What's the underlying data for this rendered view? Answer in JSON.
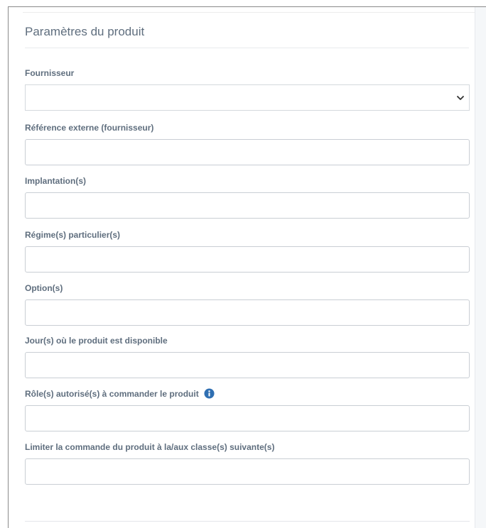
{
  "panel": {
    "title": "Paramètres du produit"
  },
  "fields": {
    "fournisseur": {
      "label": "Fournisseur",
      "value": ""
    },
    "reference_externe": {
      "label": "Référence externe (fournisseur)",
      "value": ""
    },
    "implantations": {
      "label": "Implantation(s)",
      "value": ""
    },
    "regimes": {
      "label": "Régime(s) particulier(s)",
      "value": ""
    },
    "options": {
      "label": "Option(s)",
      "value": ""
    },
    "jours": {
      "label": "Jour(s) où le produit est disponible",
      "value": ""
    },
    "roles": {
      "label": "Rôle(s) autorisé(s) à commander le produit",
      "value": "",
      "icon": "info-icon"
    },
    "classes": {
      "label": "Limiter la commande du produit à la/aux classe(s) suivante(s)",
      "value": ""
    }
  },
  "colors": {
    "label": "#5f6e7e",
    "border": "#c9ced4",
    "info_icon": "#2f6fb2"
  }
}
